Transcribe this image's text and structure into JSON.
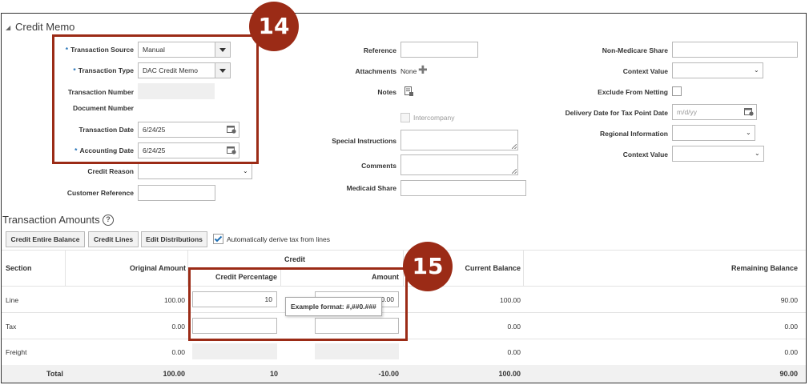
{
  "credit_memo": {
    "title": "Credit Memo",
    "left": {
      "transaction_source_label": "Transaction Source",
      "transaction_source_value": "Manual",
      "transaction_type_label": "Transaction Type",
      "transaction_type_value": "DAC Credit Memo",
      "transaction_number_label": "Transaction Number",
      "document_number_label": "Document Number",
      "transaction_date_label": "Transaction Date",
      "transaction_date_value": "6/24/25",
      "accounting_date_label": "Accounting Date",
      "accounting_date_value": "6/24/25",
      "credit_reason_label": "Credit Reason",
      "customer_reference_label": "Customer Reference"
    },
    "middle": {
      "reference_label": "Reference",
      "attachments_label": "Attachments",
      "attachments_value": "None",
      "notes_label": "Notes",
      "intercompany_label": "Intercompany",
      "special_instructions_label": "Special Instructions",
      "comments_label": "Comments",
      "medicaid_share_label": "Medicaid Share"
    },
    "right": {
      "non_medicare_share_label": "Non-Medicare Share",
      "context_value_label": "Context Value",
      "exclude_from_netting_label": "Exclude From Netting",
      "delivery_date_label": "Delivery Date for Tax Point Date",
      "delivery_date_placeholder": "m/d/yy",
      "regional_information_label": "Regional Information",
      "context_value_2_label": "Context Value"
    }
  },
  "transaction_amounts": {
    "title": "Transaction Amounts",
    "help_icon": "?",
    "buttons": {
      "credit_entire_balance": "Credit Entire Balance",
      "credit_lines": "Credit Lines",
      "edit_distributions": "Edit Distributions"
    },
    "auto_derive_label": "Automatically derive tax from lines",
    "table": {
      "headers": {
        "section": "Section",
        "original_amount": "Original Amount",
        "credit": "Credit",
        "credit_percentage": "Credit Percentage",
        "amount": "Amount",
        "current_balance": "Current Balance",
        "remaining_balance": "Remaining Balance"
      },
      "rows": [
        {
          "section": "Line",
          "original": "100.00",
          "credit_pct": "10",
          "amount": "0.00",
          "current": "100.00",
          "remaining": "90.00"
        },
        {
          "section": "Tax",
          "original": "0.00",
          "credit_pct": "",
          "amount": "",
          "current": "0.00",
          "remaining": "0.00"
        },
        {
          "section": "Freight",
          "original": "0.00",
          "credit_pct": "",
          "amount": "",
          "current": "0.00",
          "remaining": "0.00"
        }
      ],
      "total": {
        "label": "Total",
        "original": "100.00",
        "credit_pct": "10",
        "amount": "-10.00",
        "current": "100.00",
        "remaining": "90.00"
      }
    },
    "tooltip": "Example format: #,##0.###"
  },
  "callouts": {
    "step_14": "14",
    "step_15": "15"
  },
  "colors": {
    "callout": "#9b2b16",
    "required": "#1f6fb5"
  }
}
